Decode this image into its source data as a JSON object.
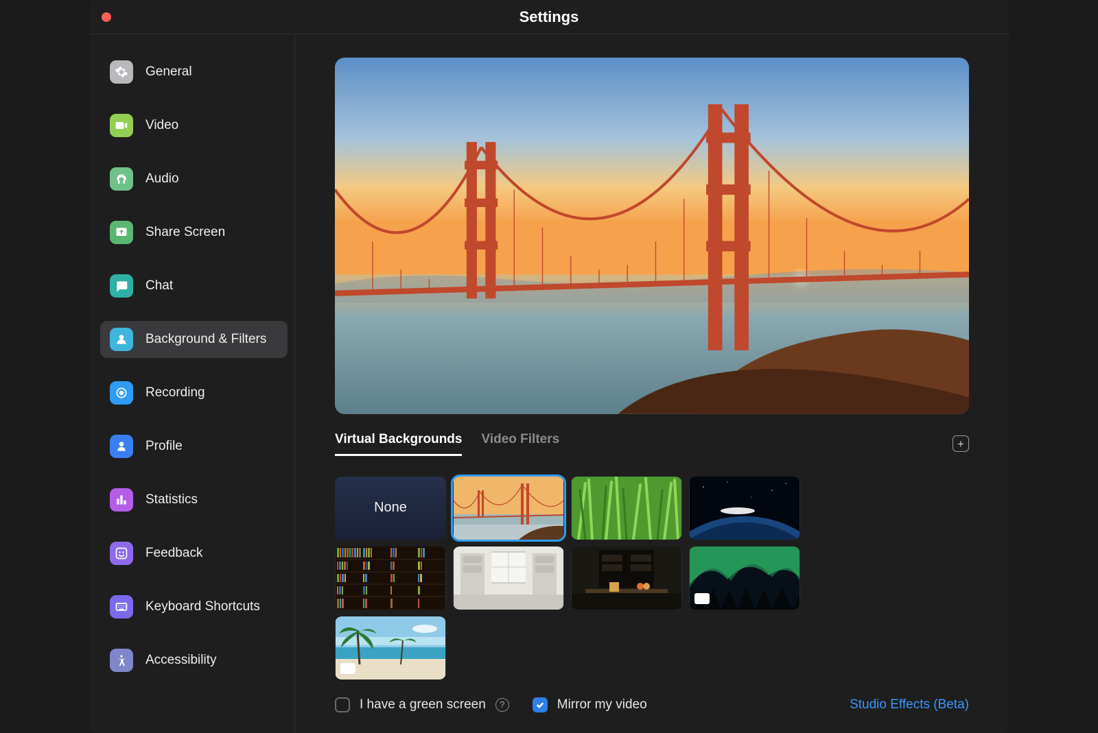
{
  "window": {
    "title": "Settings"
  },
  "sidebar": {
    "items": [
      {
        "label": "General"
      },
      {
        "label": "Video"
      },
      {
        "label": "Audio"
      },
      {
        "label": "Share Screen"
      },
      {
        "label": "Chat"
      },
      {
        "label": "Background & Filters"
      },
      {
        "label": "Recording"
      },
      {
        "label": "Profile"
      },
      {
        "label": "Statistics"
      },
      {
        "label": "Feedback"
      },
      {
        "label": "Keyboard Shortcuts"
      },
      {
        "label": "Accessibility"
      }
    ],
    "active_index": 5
  },
  "tabs": {
    "virtual_backgrounds": "Virtual Backgrounds",
    "video_filters": "Video Filters",
    "active": "virtual_backgrounds"
  },
  "thumbnails": {
    "none_label": "None",
    "selected_index": 1,
    "items": [
      {
        "kind": "none"
      },
      {
        "kind": "bridge"
      },
      {
        "kind": "grass"
      },
      {
        "kind": "earth"
      },
      {
        "kind": "library"
      },
      {
        "kind": "room-white"
      },
      {
        "kind": "room-dark"
      },
      {
        "kind": "aurora",
        "is_video": true
      },
      {
        "kind": "beach",
        "is_video": true
      }
    ]
  },
  "footer": {
    "green_screen_label": "I have a green screen",
    "green_screen_checked": false,
    "mirror_label": "Mirror my video",
    "mirror_checked": true,
    "studio_effects": "Studio Effects (Beta)"
  }
}
